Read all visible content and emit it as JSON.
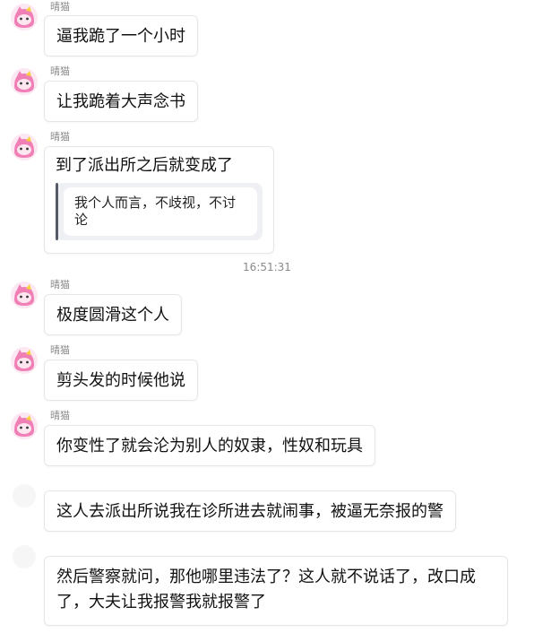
{
  "sender_name": "晴猫",
  "timestamp": "16:51:31",
  "messages": [
    {
      "text": "逼我跪了一个小时"
    },
    {
      "text": "让我跪着大声念书"
    },
    {
      "text": "到了派出所之后就变成了",
      "quote": "我个人而言，不歧视，不讨论"
    },
    {
      "text": "极度圆滑这个人"
    },
    {
      "text": "剪头发的时候他说"
    },
    {
      "text": "你变性了就会沦为别人的奴隶，性奴和玩具"
    },
    {
      "text": "这人去派出所说我在诊所进去就闹事，被逼无奈报的警"
    },
    {
      "text": "然后警察就问，那他哪里违法了？这人就不说话了，改口成了，大夫让我报警我就报警了"
    }
  ],
  "colors": {
    "avatar_pink": "#f07fb6",
    "avatar_yellow": "#f7d03a",
    "bubble_border": "#e6e6e6",
    "meta_text": "#8a8a8a"
  },
  "icons": [
    "avatar-pink-cat"
  ]
}
